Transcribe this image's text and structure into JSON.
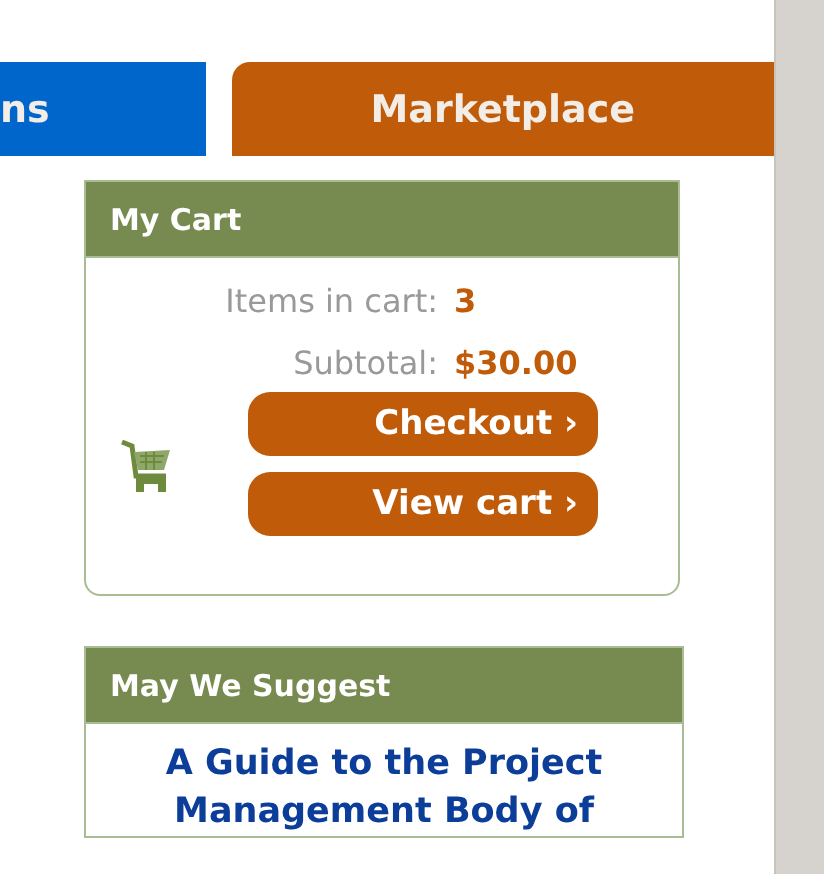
{
  "tabs": [
    {
      "label": "ns",
      "color": "#0066cc"
    },
    {
      "label": "Marketplace",
      "color": "#bf5b09"
    }
  ],
  "cart": {
    "title": "My Cart",
    "items_label": "Items in cart:",
    "items_value": "3",
    "subtotal_label": "Subtotal:",
    "subtotal_value": "$30.00",
    "buttons": [
      {
        "label": "Checkout",
        "arrow": "›"
      },
      {
        "label": "View cart",
        "arrow": "›"
      }
    ]
  },
  "suggest": {
    "title": "May We Suggest",
    "link": "A Guide to the Project Management Body of"
  }
}
